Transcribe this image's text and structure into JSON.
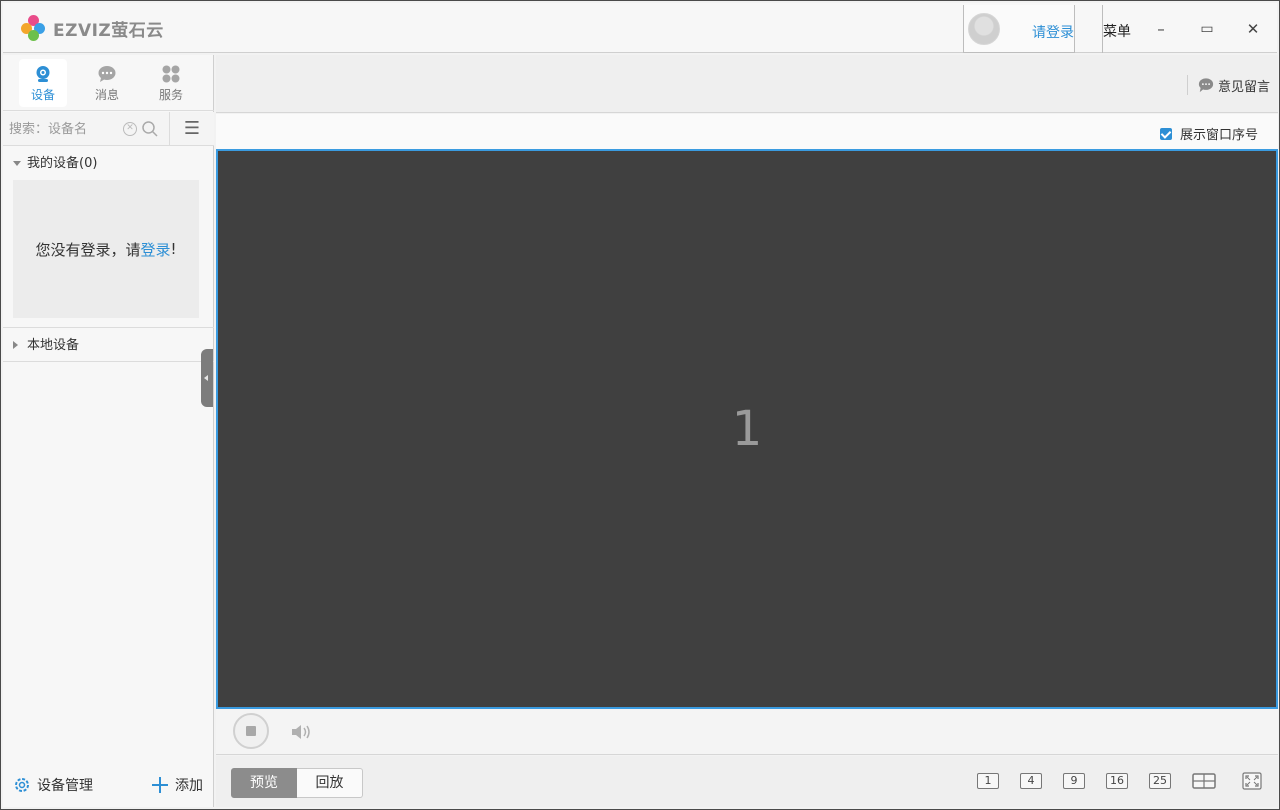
{
  "app": {
    "logo_text": "EZVIZ萤石云",
    "login_link": "请登录",
    "menu_label": "菜单",
    "minimize": "–",
    "maximize": "▭",
    "close": "✕"
  },
  "sidebar": {
    "tabs": [
      {
        "label": "设备",
        "icon": "camera-icon",
        "active": true
      },
      {
        "label": "消息",
        "icon": "message-icon",
        "active": false
      },
      {
        "label": "服务",
        "icon": "grid-icon",
        "active": false
      }
    ],
    "search_placeholder": "搜索：设备名",
    "my_devices_label": "我的设备(0)",
    "empty_text_prefix": "您没有登录，请",
    "empty_text_link": "登录",
    "empty_text_suffix": "!",
    "local_devices_label": "本地设备",
    "footer": {
      "manage_label": "设备管理",
      "add_label": "添加"
    }
  },
  "main": {
    "feedback_label": "意见留言",
    "show_window_index_label": "展示窗口序号",
    "show_window_index_checked": true,
    "window_number": "1",
    "mode_tabs": [
      {
        "label": "预览",
        "active": true
      },
      {
        "label": "回放",
        "active": false
      }
    ],
    "layouts": [
      "1",
      "4",
      "9",
      "16",
      "25"
    ]
  },
  "colors": {
    "accent": "#2d8fd5",
    "video_bg": "#404040",
    "video_border": "#3a9be0"
  }
}
